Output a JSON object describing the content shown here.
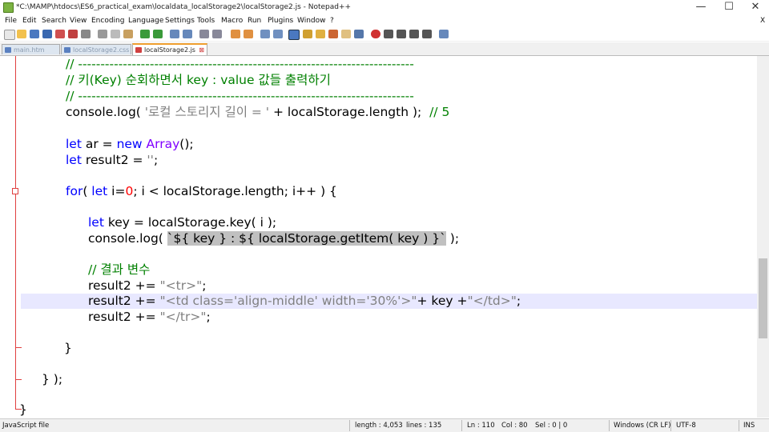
{
  "window": {
    "title": "*C:\\MAMP\\htdocs\\ES6_practical_exam\\localdata_localStorage2\\localStorage2.js - Notepad++",
    "minimize_glyph": "—",
    "maximize_glyph": "☐",
    "close_glyph": "✕",
    "doc_close_glyph": "X"
  },
  "menu": [
    "File",
    "Edit",
    "Search",
    "View",
    "Encoding",
    "Language",
    "Settings",
    "Tools",
    "Macro",
    "Run",
    "Plugins",
    "Window",
    "?"
  ],
  "tabs": [
    {
      "label": "main.htm",
      "active": false
    },
    {
      "label": "localStorage2.css",
      "active": false
    },
    {
      "label": "localStorage2.js",
      "active": true
    }
  ],
  "code": {
    "l1": "// ---------------------------------------------------------------------------",
    "l2": "// 키(Key) 순회하면서 key : value 값들 출력하기",
    "l3": "// ---------------------------------------------------------------------------",
    "l4_a": "console.log( ",
    "l4_b": "'로컬 스토리지 길이 = '",
    "l4_c": " + localStorage.length );  ",
    "l4_d": "// 5",
    "l6_kw1": "let",
    "l6_a": " ar = ",
    "l6_kw2": "new",
    "l6_b": " ",
    "l6_kw3": "Array",
    "l6_c": "();",
    "l7_kw": "let",
    "l7_a": " result2 = ",
    "l7_b": "''",
    "l7_c": ";",
    "l9_kw1": "for",
    "l9_a": "( ",
    "l9_kw2": "let",
    "l9_b": " i=",
    "l9_num": "0",
    "l9_c": "; i < localStorage.length; i++ ) {",
    "l11_kw": "let",
    "l11_a": " key = localStorage.key( i );",
    "l12_a": "console.log( ",
    "l12_sel": "`${ key } : ${ localStorage.getItem( key ) }`",
    "l12_b": " );",
    "l14": "// 결과 변수",
    "l15_a": "result2 += ",
    "l15_b": "\"<tr>\"",
    "l15_c": ";",
    "l16_a": "result2 += ",
    "l16_b": "\"<td class='align-middle' width='30%'>\"",
    "l16_c": "+ key +",
    "l16_d": "\"</td>\"",
    "l16_e": ";",
    "l17_a": "result2 += ",
    "l17_b": "\"</tr>\"",
    "l17_c": ";",
    "l19": "}",
    "l21": "} );",
    "l23": "}"
  },
  "status": {
    "file_type": "JavaScript file",
    "length": "length : 4,053",
    "lines": "lines : 135",
    "ln": "Ln : 110",
    "col": "Col : 80",
    "sel": "Sel : 0 | 0",
    "eol": "Windows (CR LF)",
    "encoding": "UTF-8",
    "mode": "INS"
  },
  "colors": {
    "comment": "#008000",
    "keyword": "#0000ff",
    "string": "#808080",
    "number": "#ff0000",
    "current_line": "#e8e8ff",
    "selection": "#c0c0c0"
  }
}
